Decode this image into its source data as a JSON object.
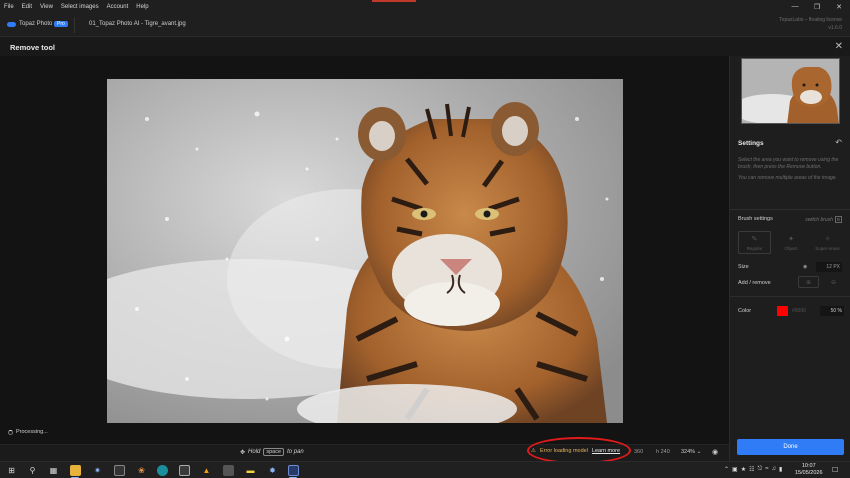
{
  "menu": [
    "File",
    "Edit",
    "View",
    "Select images",
    "Account",
    "Help"
  ],
  "app": {
    "brand": "Topaz Photo",
    "badge": "Pro",
    "filename": "01_Topaz Photo AI - Tigre_avant.jpg",
    "license_line1": "TopazLabs – floating license",
    "license_line2": "v1.6.0"
  },
  "header": {
    "title": "Remove tool"
  },
  "status": {
    "processing": "Processing..."
  },
  "bottom": {
    "hint_before": "Hold",
    "hint_key": "space",
    "hint_after": "to pan",
    "error_text": "Error loading model",
    "learn_more": "Learn more",
    "width": "360",
    "height_label": "h",
    "height": "240",
    "zoom": "324%"
  },
  "panel": {
    "settings_title": "Settings",
    "desc1": "Select the area you want to remove using the brush, then press the Remove button.",
    "desc2": "You can remove multiple areas of the image.",
    "brush_settings": "Brush settings",
    "switch_brush": "switch brush",
    "switch_key": "B",
    "brushes": [
      "Regular",
      "Object",
      "Super erase"
    ],
    "size_label": "Size",
    "size_value": "12",
    "size_unit": "PX",
    "add_remove_label": "Add / remove",
    "color_label": "Color",
    "color_hex": "#0000",
    "opacity": "50 %",
    "done": "Done"
  },
  "taskbar": {
    "time": "10:07",
    "date": "15/05/2026"
  },
  "colors": {
    "accent": "#2f7cf6",
    "error_circle": "#e11b1b",
    "brush_color": "#ff0000"
  }
}
